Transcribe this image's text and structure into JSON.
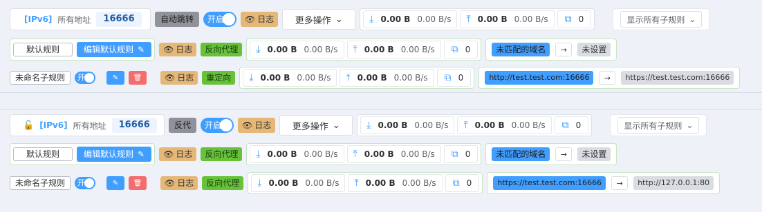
{
  "blocks": [
    {
      "header": {
        "ipv6": "[IPv6]",
        "all_addr": "所有地址",
        "port": "16666",
        "mode": "自动跳转",
        "toggle": "开启",
        "log": "日志",
        "more": "更多操作",
        "down_bytes": "0.00 B",
        "down_rate": "0.00 B/s",
        "up_bytes": "0.00 B",
        "up_rate": "0.00 B/s",
        "conn": "0",
        "show_rules": "显示所有子规则"
      },
      "default_rule": {
        "label": "默认规则",
        "edit": "编辑默认规则",
        "log": "日志",
        "type": "反向代理",
        "down_bytes": "0.00 B",
        "down_rate": "0.00 B/s",
        "up_bytes": "0.00 B",
        "up_rate": "0.00 B/s",
        "conn": "0",
        "from": "未匹配的域名",
        "to": "未设置"
      },
      "sub_rule": {
        "name": "未命名子规则",
        "toggle": "开",
        "log": "日志",
        "type": "重定向",
        "down_bytes": "0.00 B",
        "down_rate": "0.00 B/s",
        "up_bytes": "0.00 B",
        "up_rate": "0.00 B/s",
        "conn": "0",
        "from": "http://test.test.com:16666",
        "to": "https://test.test.com:16666"
      }
    },
    {
      "header": {
        "ipv6": "[IPv6]",
        "all_addr": "所有地址",
        "port": "16666",
        "mode": "反代",
        "toggle": "开启",
        "log": "日志",
        "more": "更多操作",
        "down_bytes": "0.00 B",
        "down_rate": "0.00 B/s",
        "up_bytes": "0.00 B",
        "up_rate": "0.00 B/s",
        "conn": "0",
        "show_rules": "显示所有子规则"
      },
      "default_rule": {
        "label": "默认规则",
        "edit": "编辑默认规则",
        "log": "日志",
        "type": "反向代理",
        "down_bytes": "0.00 B",
        "down_rate": "0.00 B/s",
        "up_bytes": "0.00 B",
        "up_rate": "0.00 B/s",
        "conn": "0",
        "from": "未匹配的域名",
        "to": "未设置"
      },
      "sub_rule": {
        "name": "未命名子规则",
        "toggle": "开",
        "log": "日志",
        "type": "反向代理",
        "down_bytes": "0.00 B",
        "down_rate": "0.00 B/s",
        "up_bytes": "0.00 B",
        "up_rate": "0.00 B/s",
        "conn": "0",
        "from": "https://test.test.com:16666",
        "to": "http://127.0.0.1:80"
      }
    }
  ]
}
